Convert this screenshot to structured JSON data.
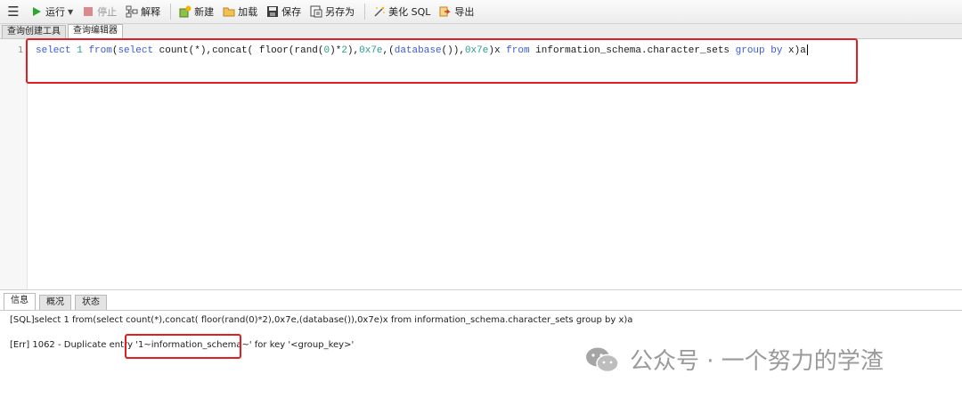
{
  "toolbar": {
    "run": "运行",
    "stop": "停止",
    "explain": "解释",
    "new": "新建",
    "load": "加载",
    "save": "保存",
    "save_as": "另存为",
    "beautify": "美化 SQL",
    "export": "导出"
  },
  "tabs": {
    "query_builder": "查询创建工具",
    "query_editor": "查询编辑器"
  },
  "editor": {
    "line_number": "1",
    "tokens": {
      "t1": "select",
      "t2": " ",
      "t3": "1",
      "t4": " ",
      "t5": "from",
      "t6": "(",
      "t7": "select",
      "t8": " count(*),concat( floor(rand(",
      "t9": "0",
      "t10": ")*",
      "t11": "2",
      "t12": "),",
      "t13": "0x7e",
      "t14": ",(",
      "t15": "database",
      "t16": "()),",
      "t17": "0x7e",
      "t18": ")x ",
      "t19": "from",
      "t20": " information_schema.character_sets ",
      "t21": "group",
      "t22": " ",
      "t23": "by",
      "t24": " x)a"
    }
  },
  "bottom_tabs": {
    "info": "信息",
    "overview": "概况",
    "status": "状态"
  },
  "messages": {
    "sql_line": "[SQL]select 1 from(select count(*),concat( floor(rand(0)*2),0x7e,(database()),0x7e)x from information_schema.character_sets group by x)a",
    "err_prefix": "[Err] 1062 - Duplicate entry ",
    "err_entry": "'1~information_schema~'",
    "err_suffix": " for key '<group_key>'"
  },
  "watermark": {
    "text": "公众号 · 一个努力的学渣"
  },
  "colors": {
    "keyword": "#3b5bdb",
    "number": "#2a9d8f",
    "highlight": "#e02020"
  }
}
